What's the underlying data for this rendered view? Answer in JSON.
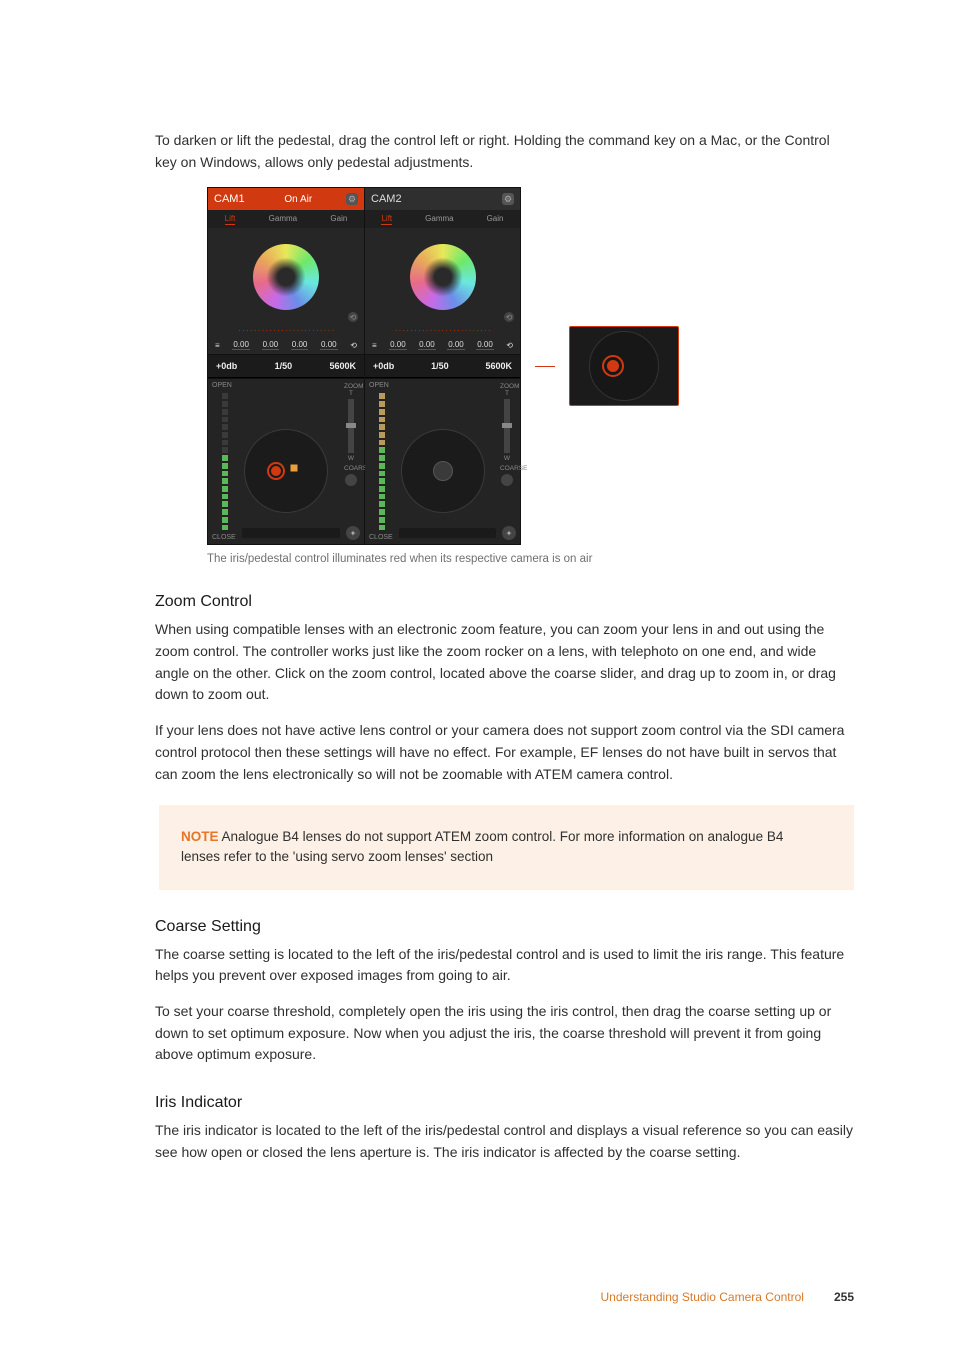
{
  "intro": "To darken or lift the pedestal, drag the control left or right. Holding the command key on a Mac, or the Control key on Windows, allows only pedestal adjustments.",
  "caption": "The iris/pedestal control illuminates red when its respective camera is on air",
  "zoom": {
    "heading": "Zoom Control",
    "p1": "When using compatible lenses with an electronic zoom feature, you can zoom your lens in and out using the zoom control. The controller works just like the zoom rocker on a lens, with telephoto on one end, and wide angle on the other. Click on the zoom control, located above the coarse slider, and drag up to zoom in, or drag down to zoom out.",
    "p2": "If your lens does not have active lens control or your camera does not support zoom control via the SDI camera control protocol then these settings will have no effect. For example, EF lenses do not have built in servos that can zoom the lens electronically so will not be zoomable with ATEM camera control."
  },
  "note": {
    "label": "NOTE",
    "text": "  Analogue B4 lenses do not support ATEM zoom control. For more information on analogue B4 lenses refer to the 'using servo zoom lenses' section"
  },
  "coarse": {
    "heading": "Coarse Setting",
    "p1": "The coarse setting is located to the left of the iris/pedestal control and is used to limit the iris range. This feature helps you prevent over exposed images from going to air.",
    "p2": "To set your coarse threshold, completely open the iris using the iris control, then drag the coarse setting up or down to set optimum exposure. Now when you adjust the iris, the coarse threshold will prevent it from going above optimum exposure."
  },
  "iris": {
    "heading": "Iris Indicator",
    "p1": "The iris indicator is located to the left of the iris/pedestal control and displays a visual reference so you can easily see how open or closed the lens aperture is. The iris indicator is affected by the coarse setting."
  },
  "footer": {
    "chapter": "Understanding Studio Camera Control",
    "page": "255"
  },
  "ui": {
    "cam1": {
      "title": "CAM1",
      "status": "On Air"
    },
    "cam2": {
      "title": "CAM2"
    },
    "tabs": {
      "lift": "Lift",
      "gamma": "Gamma",
      "gain": "Gain"
    },
    "values": {
      "v1": "0.00",
      "v2": "0.00",
      "v3": "0.00",
      "v4": "0.00"
    },
    "bottom": {
      "gain": "+0db",
      "shutter": "1/50",
      "wb": "5600K"
    },
    "irisLabels": {
      "open": "OPEN",
      "close": "CLOSE",
      "zoom": "ZOOM",
      "coarse": "COARSE",
      "t": "T",
      "w": "W"
    }
  }
}
